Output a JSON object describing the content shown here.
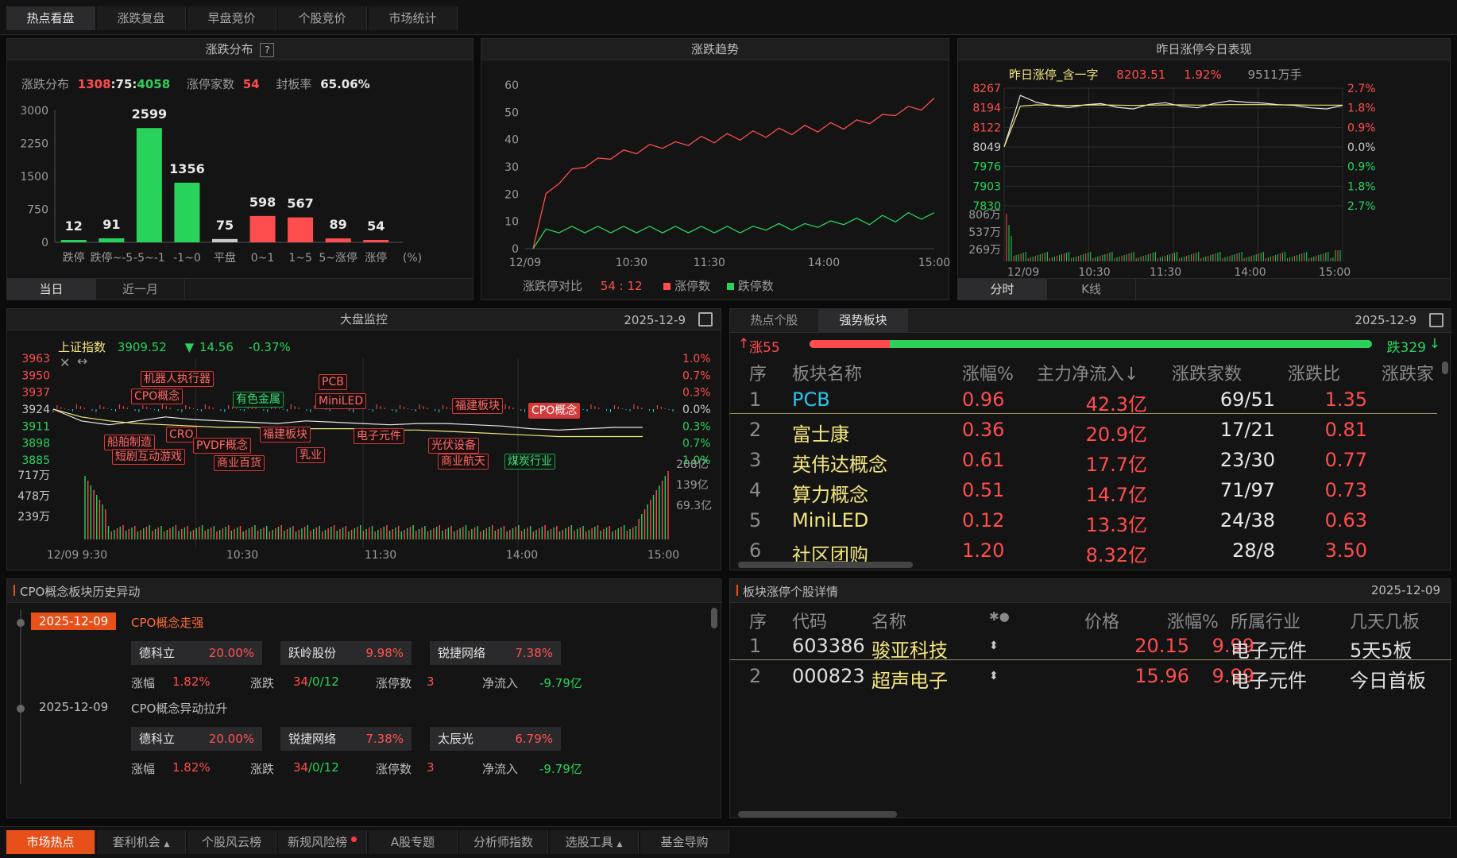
{
  "top_tabs": [
    "热点看盘",
    "涨跌复盘",
    "早盘竞价",
    "个股竞价",
    "市场统计"
  ],
  "dist": {
    "title": "涨跌分布",
    "help": "?",
    "summary_label": "涨跌分布",
    "up": "1308",
    "flat": "75",
    "down": "4058",
    "sep": ":",
    "limit_label": "涨停家数",
    "limit_value": "54",
    "seal_label": "封板率",
    "seal_value": "65.06%",
    "subtabs": [
      "当日",
      "近一月"
    ]
  },
  "chart_data": [
    {
      "type": "bar",
      "title": "涨跌分布",
      "categories": [
        "跌停",
        "跌停~-5",
        "-5~-1",
        "-1~0",
        "平盘",
        "0~1",
        "1~5",
        "5~涨停",
        "涨停"
      ],
      "values": [
        12,
        91,
        2599,
        1356,
        75,
        598,
        567,
        89,
        54
      ],
      "unit": "(%)",
      "ylim": [
        0,
        3000
      ],
      "yticks": [
        "3000",
        "2250",
        "1500",
        "750",
        "0"
      ],
      "colors": [
        "#29d35b",
        "#29d35b",
        "#29d35b",
        "#29d35b",
        "#c9c9c9",
        "#ff4d4d",
        "#ff4d4d",
        "#ff4d4d",
        "#ff4d4d"
      ]
    },
    {
      "type": "line",
      "title": "涨跌趋势",
      "x_ticks": [
        "12/09",
        "10:30",
        "11:30",
        "14:00",
        "15:00"
      ],
      "ylim": [
        0,
        60
      ],
      "yticks": [
        "60",
        "50",
        "40",
        "30",
        "20",
        "10",
        "0"
      ],
      "series": [
        {
          "name": "涨停数",
          "color": "#ff4d4d",
          "values": [
            0,
            19,
            25,
            28,
            31,
            32,
            34,
            35,
            36,
            37,
            38,
            38,
            39,
            40,
            40,
            41,
            41,
            42,
            42,
            43,
            43,
            44,
            44,
            45,
            45,
            46,
            47,
            48,
            50,
            51,
            52,
            54
          ]
        },
        {
          "name": "跌停数",
          "color": "#29d35b",
          "values": [
            0,
            6,
            7,
            7,
            7,
            7,
            7,
            7,
            7,
            7,
            7,
            7,
            7,
            7,
            7,
            7,
            7,
            7,
            8,
            8,
            8,
            8,
            9,
            9,
            10,
            10,
            10,
            11,
            11,
            12,
            12,
            12
          ]
        }
      ],
      "legend_label": "涨跌停对比",
      "ratio": "54 : 12"
    },
    {
      "type": "line",
      "title": "昨日涨停今日表现",
      "x_ticks": [
        "12/09",
        "10:30",
        "11:30",
        "14:00",
        "15:00"
      ],
      "yticks_left": [
        "8267",
        "8194",
        "8122",
        "8049",
        "7976",
        "7903",
        "7830"
      ],
      "yticks_right": [
        "2.7%",
        "1.8%",
        "0.9%",
        "0.0%",
        "0.9%",
        "1.8%",
        "2.7%"
      ],
      "vol_ticks": [
        "806万",
        "537万",
        "269万"
      ],
      "series": [
        {
          "name": "昨日涨停_含一字",
          "color": "#e8e8e8",
          "values": [
            8049,
            8240,
            8214,
            8203,
            8195,
            8205,
            8210,
            8196,
            8190,
            8207,
            8213,
            8200,
            8194,
            8210,
            8220,
            8215,
            8212,
            8206,
            8203,
            8194,
            8190,
            8203
          ]
        },
        {
          "name": "均价",
          "color": "#f4e67a",
          "values": [
            8049,
            8200,
            8205,
            8204,
            8203,
            8204,
            8205,
            8204,
            8203,
            8204,
            8205,
            8205,
            8204,
            8205,
            8206,
            8206,
            8206,
            8205,
            8205,
            8204,
            8204,
            8204
          ]
        }
      ],
      "price": "8203.51",
      "pct": "1.92%",
      "amount": "9511万手"
    },
    {
      "type": "line",
      "title": "大盘监控",
      "x_ticks": [
        "12/09  9:30",
        "10:30",
        "11:30",
        "14:00",
        "15:00"
      ],
      "yticks_left": [
        "3963",
        "3950",
        "3937",
        "3924",
        "3911",
        "3898",
        "3885"
      ],
      "yticks_right": [
        "1.0%",
        "0.7%",
        "0.3%",
        "0.0%",
        "0.3%",
        "0.7%",
        "1.0%"
      ],
      "vol_ticks_left": [
        "717万",
        "478万",
        "239万"
      ],
      "vol_ticks_right": [
        "208亿",
        "139亿",
        "69.3亿"
      ],
      "series": [
        {
          "name": "上证指数",
          "color": "#e8e8e8",
          "values": [
            3924,
            3915,
            3912,
            3915,
            3918,
            3916,
            3915,
            3914,
            3913,
            3915,
            3914,
            3913,
            3912,
            3913,
            3913,
            3912,
            3911,
            3909,
            3908,
            3909,
            3910,
            3910
          ]
        },
        {
          "name": "均价",
          "color": "#f4e67a",
          "values": [
            3924,
            3918,
            3915,
            3913,
            3912,
            3911,
            3910,
            3910,
            3909,
            3909,
            3909,
            3909,
            3908,
            3908,
            3907,
            3906,
            3905,
            3904,
            3903,
            3903,
            3903,
            3903
          ]
        }
      ]
    }
  ],
  "trend": {
    "title": "涨跌趋势",
    "legend_label": "涨跌停对比",
    "ratio": "54 : 12",
    "legend_up": "涨停数",
    "legend_down": "跌停数"
  },
  "yest": {
    "title": "昨日涨停今日表现",
    "series_name": "昨日涨停_含一字",
    "price": "8203.51",
    "pct": "1.92%",
    "amount": "9511万手",
    "subtabs": [
      "分时",
      "K线"
    ]
  },
  "market": {
    "title": "大盘监控",
    "date": "2025-12-9",
    "index_name": "上证指数",
    "index_value": "3909.52",
    "change_arrow": "▼",
    "change": "14.56",
    "change_pct": "-0.37%",
    "tags": [
      {
        "t": "机器人执行器",
        "c": "r"
      },
      {
        "t": "CPO概念",
        "c": "r"
      },
      {
        "t": "有色金属",
        "c": "g"
      },
      {
        "t": "PCB",
        "c": "r"
      },
      {
        "t": "MiniLED",
        "c": "r"
      },
      {
        "t": "福建板块",
        "c": "r"
      },
      {
        "t": "CPO概念",
        "c": "sel"
      },
      {
        "t": "船舶制造",
        "c": "r"
      },
      {
        "t": "CRO",
        "c": "r"
      },
      {
        "t": "短剧互动游戏",
        "c": "r"
      },
      {
        "t": "PVDF概念",
        "c": "r"
      },
      {
        "t": "福建板块",
        "c": "r"
      },
      {
        "t": "乳业",
        "c": "r"
      },
      {
        "t": "商业百货",
        "c": "r"
      },
      {
        "t": "电子元件",
        "c": "r"
      },
      {
        "t": "光伏设备",
        "c": "r"
      },
      {
        "t": "商业航天",
        "c": "r"
      },
      {
        "t": "煤炭行业",
        "c": "g"
      }
    ]
  },
  "sectors": {
    "tabs": [
      "热点个股",
      "强势板块"
    ],
    "date": "2025-12-9",
    "up": "涨55",
    "down": "跌329",
    "up_ratio": 0.143,
    "headers": [
      "序",
      "板块名称",
      "涨幅%",
      "主力净流入↓",
      "涨跌家数",
      "涨跌比",
      "涨跌家"
    ],
    "rows": [
      [
        "1",
        "PCB",
        "0.96",
        "42.3亿",
        "69/51",
        "1.35"
      ],
      [
        "2",
        "富士康",
        "0.36",
        "20.9亿",
        "17/21",
        "0.81"
      ],
      [
        "3",
        "英伟达概念",
        "0.61",
        "17.7亿",
        "23/30",
        "0.77"
      ],
      [
        "4",
        "算力概念",
        "0.51",
        "14.7亿",
        "71/97",
        "0.73"
      ],
      [
        "5",
        "MiniLED",
        "0.12",
        "13.3亿",
        "24/38",
        "0.63"
      ],
      [
        "6",
        "社区团购",
        "1.20",
        "8.32亿",
        "28/8",
        "3.50"
      ]
    ]
  },
  "history": {
    "title": "CPO概念板块历史异动",
    "events": [
      {
        "date": "2025-12-09",
        "title": "CPO概念走强",
        "stocks": [
          [
            "德科立",
            "20.00%"
          ],
          [
            "跃岭股份",
            "9.98%"
          ],
          [
            "锐捷网络",
            "7.38%"
          ]
        ],
        "zf_label": "涨幅",
        "zf": "1.82%",
        "zd_label": "涨跌",
        "zd_up": "34",
        "zd_rest": "/0/12",
        "zt_label": "涨停数",
        "zt": "3",
        "jl_label": "净流入",
        "jl": "-9.79亿"
      },
      {
        "date": "2025-12-09",
        "title": "CPO概念异动拉升",
        "stocks": [
          [
            "德科立",
            "20.00%"
          ],
          [
            "锐捷网络",
            "7.38%"
          ],
          [
            "太辰光",
            "6.79%"
          ]
        ],
        "zf_label": "涨幅",
        "zf": "1.82%",
        "zd_label": "涨跌",
        "zd_up": "34",
        "zd_rest": "/0/12",
        "zt_label": "涨停数",
        "zt": "3",
        "jl_label": "净流入",
        "jl": "-9.79亿"
      }
    ]
  },
  "limitup": {
    "title": "板块涨停个股详情",
    "date": "2025-12-09",
    "headers": [
      "序",
      "代码",
      "名称",
      "✱●",
      "价格",
      "涨幅%",
      "所属行业",
      "几天几板"
    ],
    "rows": [
      [
        "1",
        "603386",
        "骏亚科技",
        "⬍",
        "20.15",
        "9.99",
        "电子元件",
        "5天5板"
      ],
      [
        "2",
        "000823",
        "超声电子",
        "⬍",
        "15.96",
        "9.99",
        "电子元件",
        "今日首板"
      ]
    ]
  },
  "bottom_tabs": [
    "市场热点",
    "套利机会",
    "个股风云榜",
    "新规风险榜",
    "A股专题",
    "分析师指数",
    "选股工具",
    "基金导购"
  ]
}
